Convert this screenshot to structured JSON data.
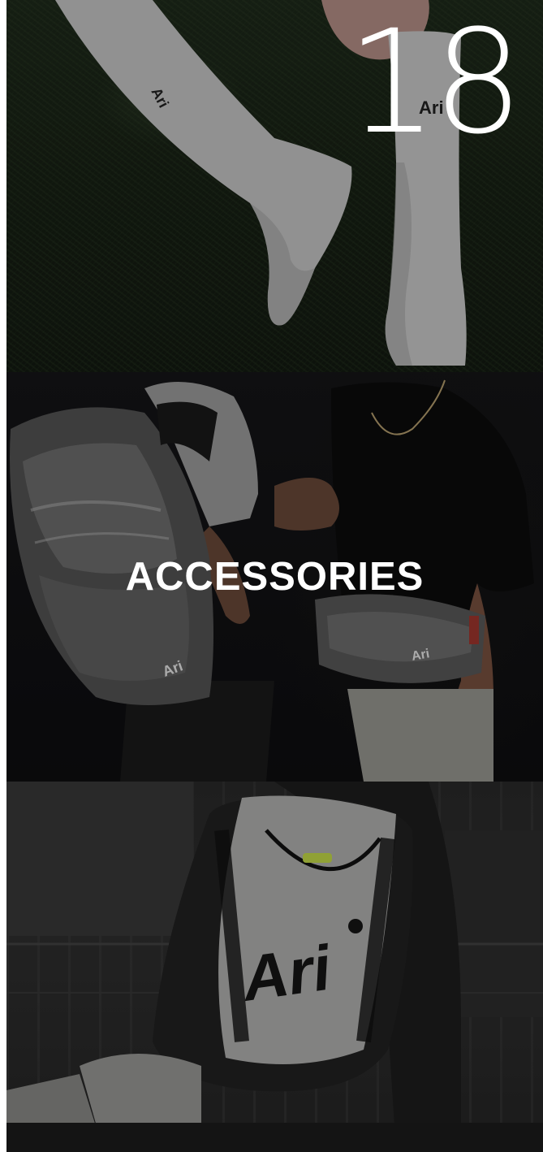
{
  "hero": {
    "number": "18"
  },
  "accessories": {
    "title": "ACCESSORIES",
    "logo_text": "Ari"
  },
  "backpack": {
    "logo_text": "Ari"
  }
}
